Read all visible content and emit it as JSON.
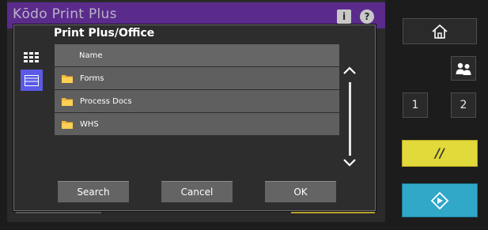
{
  "app": {
    "title": "Kōdo Print Plus",
    "info_icon": "info-icon",
    "help_icon": "help-icon"
  },
  "dialog": {
    "title": "Print Plus/Office",
    "view_modes": [
      {
        "name": "grid-view",
        "icon": "grid-icon",
        "active": false
      },
      {
        "name": "list-view",
        "icon": "list-icon",
        "active": true
      }
    ],
    "column_header": "Name",
    "items": [
      {
        "label": "Forms",
        "icon": "folder-icon"
      },
      {
        "label": "Process Docs",
        "icon": "folder-icon"
      },
      {
        "label": "WHS",
        "icon": "folder-icon"
      }
    ],
    "buttons": {
      "search": "Search",
      "cancel": "Cancel",
      "ok": "OK"
    }
  },
  "hardware_panel": {
    "home_icon": "home-icon",
    "user_icon": "user-switch-icon",
    "key_one": "1",
    "key_two": "2",
    "clear_label": "//",
    "start_icon": "start-icon",
    "colors": {
      "clear": "#e2d93a",
      "start": "#31a8c8",
      "accent": "#5b2b8c",
      "list_selected": "#5a5ae6"
    }
  }
}
